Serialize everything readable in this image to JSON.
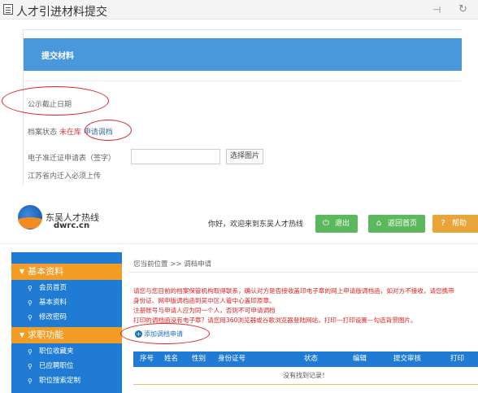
{
  "top": {
    "title": "人才引进材料提交",
    "pin_icon": "pin-icon",
    "refresh_icon": "refresh-icon",
    "card_title": "提交材料",
    "publicity_label": "公示截止日期",
    "status_label": "档案状态",
    "status_value": "未在库",
    "status_link": "申请调档",
    "upload_label": "电子准迁证申请表（签字）",
    "upload_button": "选择图片",
    "province_note": "江苏省内迁入必须上传",
    "highlight_color": "#e02020",
    "card_head_color": "#4a98dc"
  },
  "site": {
    "logo_name": "东吴人才热线",
    "logo_domain": "dwrc.cn",
    "welcome": "你好，欢迎来到东吴人才热线",
    "btn_exit": "退出",
    "btn_home": "返回首页",
    "btn_help": "帮助",
    "sidebar": {
      "section1": "基本资料",
      "section1_items": [
        "会员首页",
        "基本资料",
        "修改密码"
      ],
      "section2": "求职功能",
      "section2_items": [
        "职位收藏夹",
        "已应聘职位",
        "职位搜索定制"
      ]
    },
    "breadcrumb": "您当前位置 >> 调档申请",
    "notices": [
      "请您与您目前的档案保管机构取得联系，确认对方是否接收盖印电子章的网上申请版调档函，如对方不接收，请您携带",
      "身份证、网申版调档函到吴中区人管中心盖印原章。",
      "注册账号与申请人应为同一个人，否则不可申请调档",
      "打印的调档函没有电子章？请您用360浏览器或谷歌浏览器登陆网站，打印—打印设置—勾选背景图片。"
    ],
    "add_link": "添加调档申请",
    "table_headers": [
      "序号",
      "姓名",
      "性别",
      "身份证号",
      "状态",
      "编辑",
      "提交审核",
      "打印"
    ],
    "empty_text": "没有找到记录！",
    "sidebar_color": "#1f7bd4",
    "section_color": "#f39c26"
  }
}
